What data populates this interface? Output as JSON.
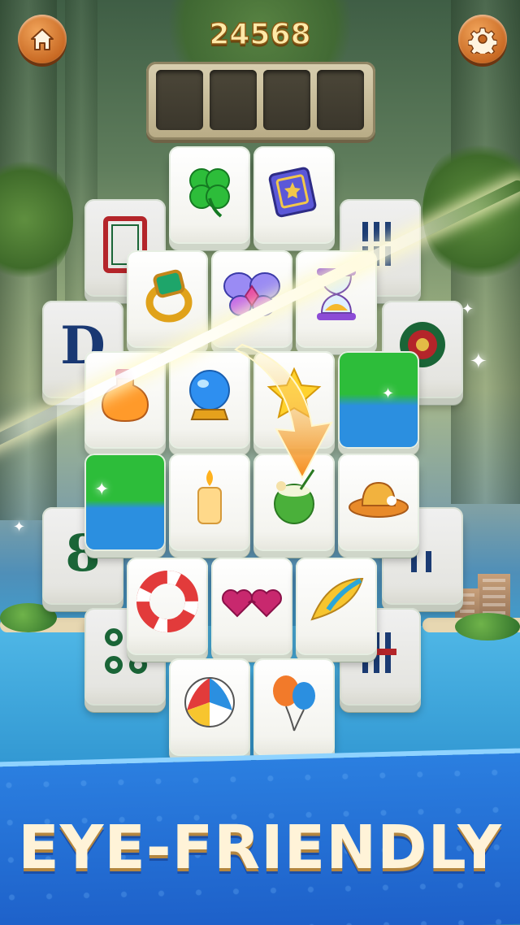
{
  "score": "24568",
  "buttons": {
    "home_icon": "home-icon",
    "settings_icon": "gear-icon"
  },
  "tray": {
    "slots": 4
  },
  "banner": {
    "text": "EYE-FRIENDLY"
  },
  "tiles": [
    {
      "name": "tile-red-frame",
      "icon": "red-frame",
      "row": 1
    },
    {
      "name": "tile-bamboo-top",
      "icon": "bamboo-bars",
      "row": 1
    },
    {
      "name": "tile-clover",
      "icon": "four-leaf-clover",
      "row": 0
    },
    {
      "name": "tile-spellbook",
      "icon": "star-book",
      "row": 0
    },
    {
      "name": "tile-letter-d",
      "icon": "letter-d",
      "glyph": "D",
      "row": 2
    },
    {
      "name": "tile-dot-wheel",
      "icon": "circle-emblem",
      "row": 2
    },
    {
      "name": "tile-ring",
      "icon": "emerald-ring",
      "row": 2
    },
    {
      "name": "tile-butterfly",
      "icon": "butterfly",
      "row": 2
    },
    {
      "name": "tile-hourglass",
      "icon": "hourglass",
      "row": 2
    },
    {
      "name": "tile-potion",
      "icon": "potion-bottle",
      "row": 3
    },
    {
      "name": "tile-crystal-ball",
      "icon": "crystal-ball",
      "row": 3
    },
    {
      "name": "tile-star",
      "icon": "star",
      "row": 3
    },
    {
      "name": "tile-green-blue",
      "icon": "color-tile",
      "row": 3
    },
    {
      "name": "tile-number-8",
      "icon": "number-eight",
      "glyph": "8",
      "row": 4
    },
    {
      "name": "tile-bamboo-right",
      "icon": "bamboo-bars",
      "row": 4
    },
    {
      "name": "tile-green-left",
      "icon": "color-tile",
      "row": 4
    },
    {
      "name": "tile-candle",
      "icon": "candle",
      "row": 4
    },
    {
      "name": "tile-coconut",
      "icon": "coconut-drink",
      "row": 4
    },
    {
      "name": "tile-sun-hat",
      "icon": "sun-hat",
      "row": 4
    },
    {
      "name": "tile-circles",
      "icon": "three-circles",
      "row": 5
    },
    {
      "name": "tile-bamboo-bottom",
      "icon": "bamboo-bars",
      "row": 5
    },
    {
      "name": "tile-lifebuoy",
      "icon": "lifebuoy",
      "row": 5
    },
    {
      "name": "tile-sunglasses",
      "icon": "heart-sunglasses",
      "row": 5
    },
    {
      "name": "tile-surfboard",
      "icon": "surfboard",
      "row": 5
    },
    {
      "name": "tile-beach-ball",
      "icon": "beach-ball",
      "row": 6
    },
    {
      "name": "tile-balloons",
      "icon": "balloons",
      "row": 6
    }
  ],
  "colors": {
    "banner": "#1d5fc8",
    "score": "#ffe9a8",
    "button": "#c96a24"
  }
}
